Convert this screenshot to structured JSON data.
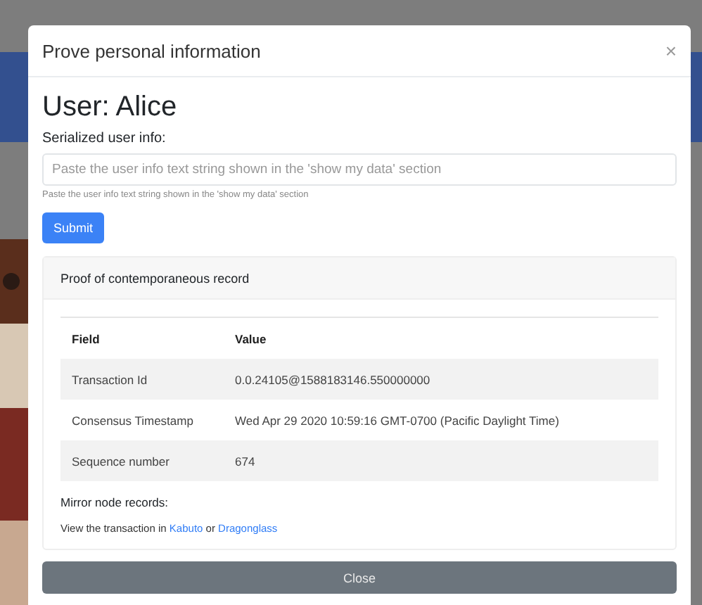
{
  "modal": {
    "title": "Prove personal information",
    "close_icon": "×"
  },
  "user_heading": "User: Alice",
  "field": {
    "label": "Serialized user info:",
    "placeholder": "Paste the user info text string shown in the 'show my data' section",
    "help": "Paste the user info text string shown in the 'show my data' section"
  },
  "submit_button": "Submit",
  "card": {
    "header": "Proof of contemporaneous record",
    "table": {
      "columns": [
        "Field",
        "Value"
      ],
      "rows": [
        [
          "Transaction Id",
          "0.0.24105@1588183146.550000000"
        ],
        [
          "Consensus Timestamp",
          "Wed Apr 29 2020 10:59:16 GMT-0700 (Pacific Daylight Time)"
        ],
        [
          "Sequence number",
          "674"
        ]
      ]
    },
    "mirror_heading": "Mirror node records:",
    "mirror_text": {
      "prefix": "View the transaction in",
      "links": [
        "Kabuto",
        "Dragonglass"
      ],
      "joiner": "or"
    }
  },
  "close_button": "Close"
}
